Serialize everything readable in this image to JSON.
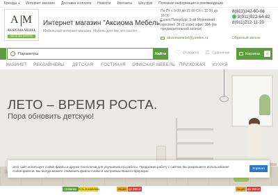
{
  "topnav": {
    "items": [
      "Бренды",
      "Интернет магазин",
      "Доставка и оплата",
      "Новости",
      "Контакты",
      "Шоу-рум",
      "Полезная информация и рекомендации"
    ]
  },
  "header": {
    "logo_letters": "A M",
    "logo_brand": "AKSIOMA MEBEL",
    "logo_sub": "АКСИОМА МЕБЕЛЬ",
    "title": "Интернет магазин \"Аксиома Мебель\"",
    "subtitle": "Мебельный интернет магазин. Мебель для тех, кто растет...",
    "hours": "Пн-Пт с 9:00 до 21:00 Сб с 11:00 до 18:00",
    "address": "Санкт-Петербург, 2-ой Муринский проспект, 38 (2 этаж) офис 38А (по предварительной записи)",
    "email": "aksiomamebel@yandex.ru",
    "phones": [
      "8(812)242-60-06",
      "8(911)922-64-82",
      "8(911)212-11-20"
    ],
    "callback": "Обратный звонок"
  },
  "search": {
    "placeholder": "Параметры",
    "button": "Найти"
  },
  "toolbar": {
    "wishlist": "Отложено",
    "compare": "Сравнение",
    "cart": "Корзина",
    "cart_count": "0"
  },
  "categories": [
    "КАБИНЕТ",
    "РЕКЛАЙНЕРЫ",
    "ДЕТСКАЯ",
    "ГОСТИНАЯ",
    "ОФИСНАЯ МЕБЕЛЬ",
    "ПРИХОЖАЯ",
    "КУХНЯ"
  ],
  "banner": {
    "title": "ЛЕТО – ВРЕМЯ РОСТА.",
    "subtitle": "Пора обновить детскую!"
  },
  "cookie": {
    "text": "Этот сайт использует cookie-файлы и другие технологии для улучшения его работы. Продолжая работу с сайтом, Вы разрешаете использование cookie-файлов. Вы всегда можете отключить файлы cookie в настройках Вашего браузера.",
    "button": "Хорошо"
  },
  "badges": [
    {
      "label": "Новинка",
      "color": "#5aa33a",
      "text_color": "#ffffff"
    },
    {
      "label": "Есть в наличии",
      "color": "#f2d21b",
      "text_color": "#333333"
    },
    {
      "label": "Акция",
      "color": "#f4a21a",
      "text_color": "#333333"
    },
    {
      "label": "до 250 кг",
      "color": "#e53935",
      "text_color": "#ffffff"
    },
    {
      "label": "Акция",
      "color": "#f4a21a",
      "text_color": "#333333"
    },
    {
      "label": "до 250 кг",
      "color": "#e53935",
      "text_color": "#ffffff"
    }
  ],
  "colors": {
    "accent": "#5a9e3a",
    "cookie_button": "#2a77c4"
  }
}
